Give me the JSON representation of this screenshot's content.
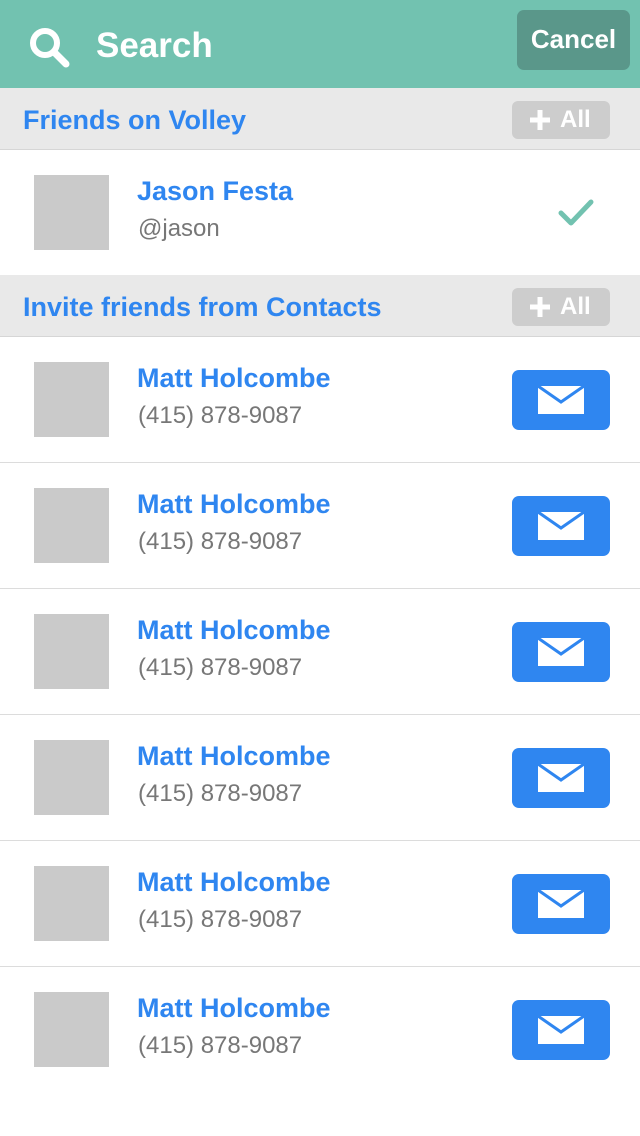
{
  "header": {
    "search_label": "Search",
    "search_icon": "search-icon",
    "cancel_label": "Cancel",
    "background_color": "#72c2b0"
  },
  "sections": {
    "friends": {
      "title": "Friends on Volley",
      "add_all_label": "All"
    },
    "contacts": {
      "title": "Invite friends from Contacts",
      "add_all_label": "All"
    }
  },
  "friends": [
    {
      "name": "Jason Festa",
      "handle": "@jason",
      "status_icon": "check-icon",
      "added": true
    }
  ],
  "contacts": [
    {
      "name": "Matt Holcombe",
      "phone": "(415) 878-9087",
      "action_icon": "mail-icon"
    },
    {
      "name": "Matt Holcombe",
      "phone": "(415) 878-9087",
      "action_icon": "mail-icon"
    },
    {
      "name": "Matt Holcombe",
      "phone": "(415) 878-9087",
      "action_icon": "mail-icon"
    },
    {
      "name": "Matt Holcombe",
      "phone": "(415) 878-9087",
      "action_icon": "mail-icon"
    },
    {
      "name": "Matt Holcombe",
      "phone": "(415) 878-9087",
      "action_icon": "mail-icon"
    },
    {
      "name": "Matt Holcombe",
      "phone": "(415) 878-9087",
      "action_icon": "mail-icon"
    }
  ],
  "colors": {
    "accent_blue": "#2f86f0",
    "check_green": "#72c2b0",
    "section_background": "#e9e9e9",
    "disabled_button": "#cdcdcd"
  }
}
